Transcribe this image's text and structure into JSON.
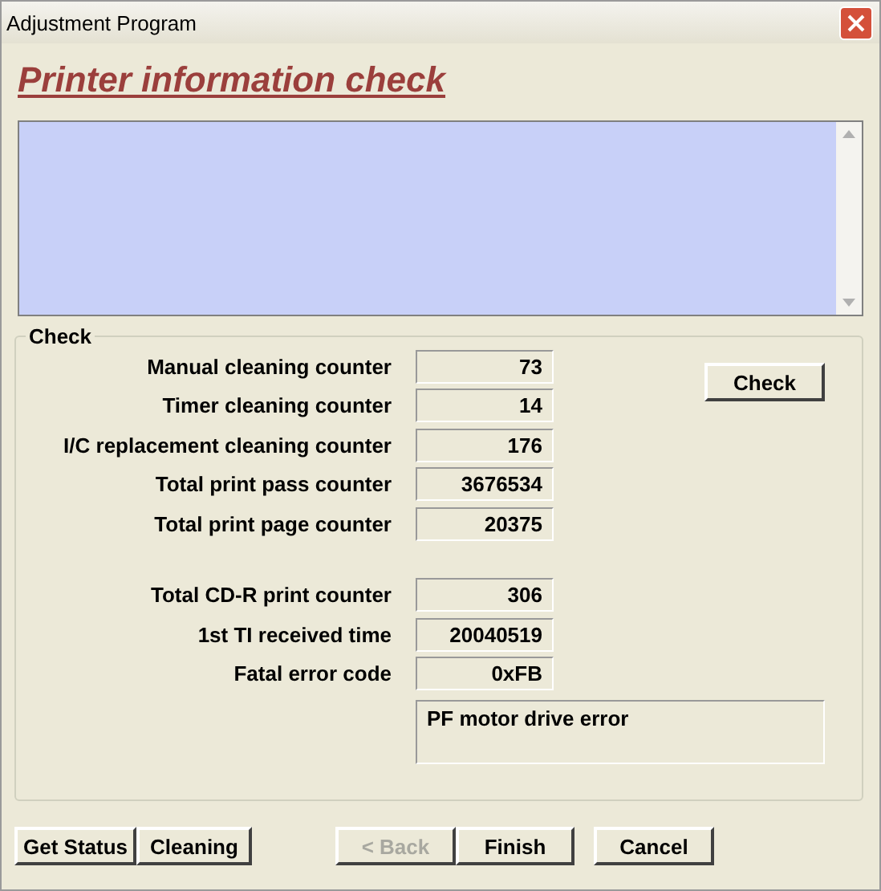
{
  "window": {
    "title": "Adjustment Program"
  },
  "heading": "Printer information check",
  "check": {
    "label": "Check",
    "groups": [
      {
        "counters": [
          {
            "label": "Manual cleaning counter",
            "value": "73"
          },
          {
            "label": "Timer cleaning counter",
            "value": "14"
          },
          {
            "label": "I/C replacement cleaning counter",
            "value": "176"
          },
          {
            "label": "Total print pass counter",
            "value": "3676534"
          },
          {
            "label": "Total print page counter",
            "value": "20375"
          }
        ]
      },
      {
        "counters": [
          {
            "label": "Total CD-R print counter",
            "value": "306"
          },
          {
            "label": "1st TI received time",
            "value": "20040519"
          },
          {
            "label": "Fatal error code",
            "value": "0xFB"
          }
        ]
      }
    ],
    "check_button": "Check",
    "error_description": "PF motor drive error"
  },
  "buttons": [
    {
      "label": "Get Status",
      "disabled": false
    },
    {
      "label": "Cleaning",
      "disabled": false
    },
    {
      "label": "< Back",
      "disabled": true
    },
    {
      "label": "Finish",
      "disabled": false
    },
    {
      "label": "Cancel",
      "disabled": false
    }
  ]
}
